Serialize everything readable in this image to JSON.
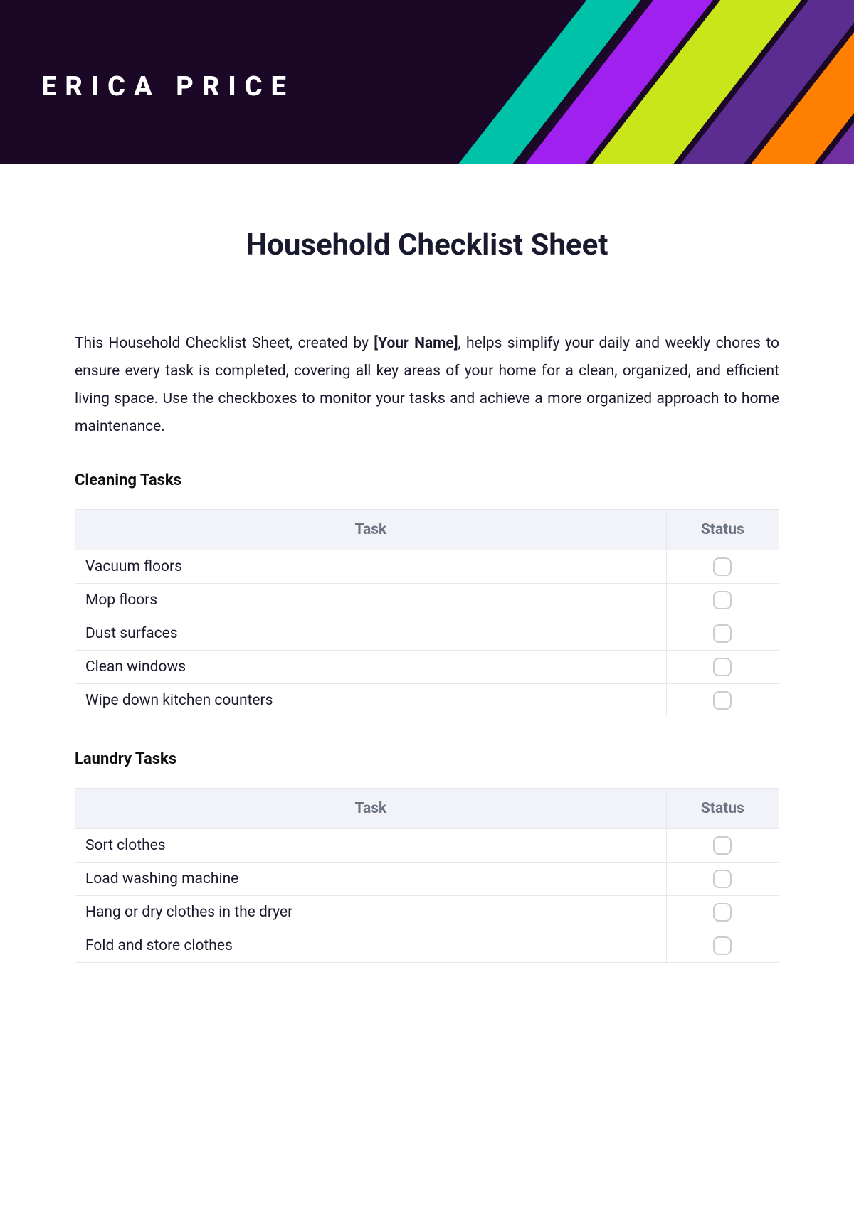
{
  "header": {
    "name": "ERICA PRICE"
  },
  "document": {
    "title": "Household Checklist Sheet",
    "intro_pre": "This Household Checklist Sheet, created by ",
    "intro_bold": "[Your Name]",
    "intro_post": ", helps simplify your daily and weekly chores to ensure every task is completed, covering all key areas of your home for a clean, organized, and efficient living space. Use the checkboxes to monitor your tasks and achieve a more organized approach to home maintenance."
  },
  "columns": {
    "task": "Task",
    "status": "Status"
  },
  "sections": [
    {
      "heading": "Cleaning Tasks",
      "tasks": [
        "Vacuum floors",
        "Mop floors",
        "Dust surfaces",
        "Clean windows",
        "Wipe down kitchen counters"
      ]
    },
    {
      "heading": "Laundry Tasks",
      "tasks": [
        "Sort clothes",
        "Load washing machine",
        "Hang or dry clothes in the dryer",
        "Fold and store clothes"
      ]
    }
  ]
}
